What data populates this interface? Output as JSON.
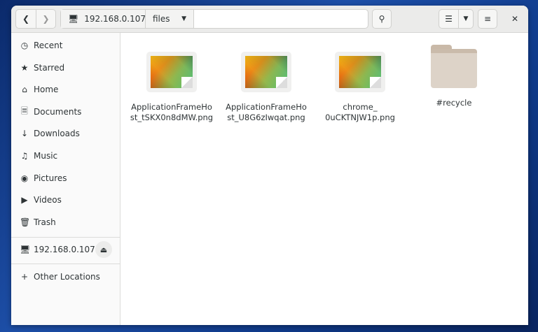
{
  "header": {
    "path_root": "192.168.0.107",
    "path_current": "files"
  },
  "sidebar": {
    "items": [
      {
        "label": "Recent",
        "icon": "clock-icon"
      },
      {
        "label": "Starred",
        "icon": "star-icon"
      },
      {
        "label": "Home",
        "icon": "home-icon"
      },
      {
        "label": "Documents",
        "icon": "document-icon"
      },
      {
        "label": "Downloads",
        "icon": "download-icon"
      },
      {
        "label": "Music",
        "icon": "music-icon"
      },
      {
        "label": "Pictures",
        "icon": "camera-icon"
      },
      {
        "label": "Videos",
        "icon": "video-icon"
      },
      {
        "label": "Trash",
        "icon": "trash-icon"
      }
    ],
    "network": "192.168.0.107",
    "other": "Other Locations"
  },
  "files": [
    {
      "l1": "ApplicationFrameHo",
      "l2": "st_tSKX0n8dMW.png",
      "type": "image"
    },
    {
      "l1": "ApplicationFrameHo",
      "l2": "st_U8G6zIwqat.png",
      "type": "image"
    },
    {
      "l1": "chrome_",
      "l2": "0uCKTNJW1p.png",
      "type": "image"
    },
    {
      "l1": "#recycle",
      "l2": "",
      "type": "folder"
    }
  ]
}
